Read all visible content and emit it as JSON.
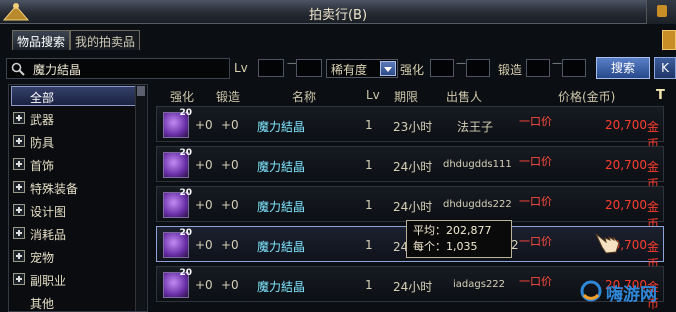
{
  "window": {
    "title": "拍卖行(B)"
  },
  "tabs": [
    {
      "label": "物品搜索",
      "active": true
    },
    {
      "label": "我的拍卖品",
      "active": false
    }
  ],
  "filters": {
    "search_value": "魔力結晶",
    "level_label": "Lv",
    "rarity_label": "稀有度",
    "enhance_label": "强化",
    "forge_label": "锻造",
    "search_button": "搜索",
    "next_button": "K"
  },
  "categories": [
    {
      "label": "全部",
      "expandable": false,
      "selected": true
    },
    {
      "label": "武器",
      "expandable": true
    },
    {
      "label": "防具",
      "expandable": true
    },
    {
      "label": "首饰",
      "expandable": true
    },
    {
      "label": "特殊装备",
      "expandable": true
    },
    {
      "label": "设计图",
      "expandable": true
    },
    {
      "label": "消耗品",
      "expandable": true
    },
    {
      "label": "宠物",
      "expandable": true
    },
    {
      "label": "副职业",
      "expandable": true
    },
    {
      "label": "其他",
      "expandable": false
    }
  ],
  "columns": {
    "enhance": "强化",
    "forge": "锻造",
    "name": "名称",
    "level": "Lv",
    "duration": "期限",
    "seller": "出售人",
    "price": "价格(金币)",
    "tool": "T"
  },
  "rows": [
    {
      "icon_level": "20",
      "enhance": "+0",
      "forge": "+0",
      "name": "魔力結晶",
      "level": "1",
      "duration": "23小时",
      "seller": "法王子",
      "buynow": "一口价",
      "price": "20,700",
      "unit": "金币"
    },
    {
      "icon_level": "20",
      "enhance": "+0",
      "forge": "+0",
      "name": "魔力結晶",
      "level": "1",
      "duration": "24小时",
      "seller": "dhdugdds111",
      "buynow": "一口价",
      "price": "20,700",
      "unit": "金币"
    },
    {
      "icon_level": "20",
      "enhance": "+0",
      "forge": "+0",
      "name": "魔力結晶",
      "level": "1",
      "duration": "24小时",
      "seller": "dhdugdds222",
      "buynow": "一口价",
      "price": "20,700",
      "unit": "金币"
    },
    {
      "icon_level": "20",
      "enhance": "+0",
      "forge": "+0",
      "name": "魔力結晶",
      "level": "1",
      "duration": "24小时",
      "seller": "2",
      "buynow": "一口价",
      "price": "20,700",
      "unit": "金币"
    },
    {
      "icon_level": "20",
      "enhance": "+0",
      "forge": "+0",
      "name": "魔力結晶",
      "level": "1",
      "duration": "24小时",
      "seller": "iadags222",
      "buynow": "一口价",
      "price": "20,700",
      "unit": "金币"
    }
  ],
  "tooltip": {
    "average_label": "平均：",
    "average_value": "202,877",
    "each_label": "每个：",
    "each_value": "1,035"
  },
  "watermark": {
    "text": "嗨游网"
  }
}
